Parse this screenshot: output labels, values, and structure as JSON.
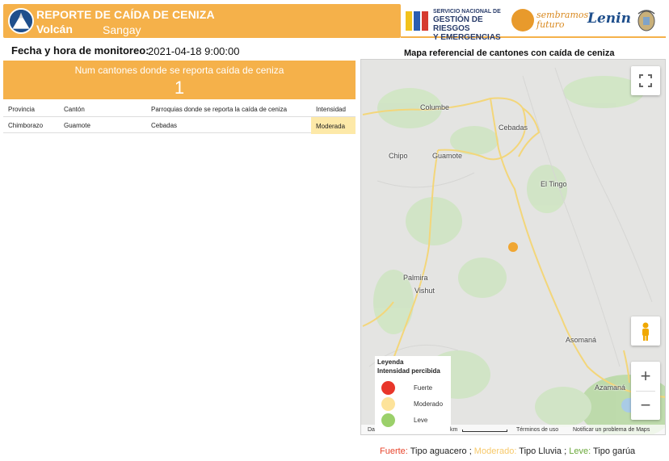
{
  "header": {
    "title": "REPORTE DE CAÍDA DE CENIZA",
    "volcano_label": "Volcán",
    "volcano_name": "Sangay"
  },
  "logos": {
    "sngre_line1": "SERVICIO NACIONAL DE",
    "sngre_line2": "GESTIÓN DE RIESGOS",
    "sngre_line3": "Y EMERGENCIAS",
    "sembramos_line1": "sembramos",
    "sembramos_line2": "futuro",
    "lenin": "Lenin"
  },
  "monitoring": {
    "label": "Fecha y hora de monitoreo:",
    "value": "2021-04-18  9:00:00"
  },
  "count_box": {
    "title": "Num cantones donde se reporta caída de ceniza",
    "value": "1"
  },
  "table": {
    "headers": [
      "Provincia",
      "Cantón",
      "Parroquias donde se reporta la caída de ceniza",
      "Intensidad"
    ],
    "rows": [
      [
        "Chimborazo",
        "Guamote",
        "Cebadas",
        "Moderada"
      ]
    ]
  },
  "map": {
    "title": "Mapa referencial de cantones con caída de ceniza",
    "places": [
      "Columbe",
      "Cebadas",
      "Chipo",
      "Guamote",
      "El Tingo",
      "Palmira",
      "Vishut",
      "Asomaná",
      "Azamaná"
    ],
    "footer_scale": "km",
    "footer_terms": "Términos de uso",
    "footer_report": "Notificar un problema de Maps",
    "footer_data": "Da"
  },
  "legend": {
    "title_line1": "Leyenda",
    "title_line2": "Intensidad percibida",
    "items": [
      {
        "label": "Fuerte",
        "color": "#e8362a"
      },
      {
        "label": "Moderado",
        "color": "#fde39a"
      },
      {
        "label": "Leve",
        "color": "#9bd06a"
      }
    ]
  },
  "notes": {
    "fuerte_label": "Fuerte:",
    "fuerte_text": " Tipo aguacero ;",
    "moderado_label": " Moderado:",
    "moderado_text": " Tipo Lluvia ;",
    "leve_label": " Leve:",
    "leve_text": " Tipo garúa"
  },
  "colors": {
    "accent": "#f5b14a",
    "intensity_moderada_cell": "#fde9a8",
    "marker": "#f0a632"
  }
}
